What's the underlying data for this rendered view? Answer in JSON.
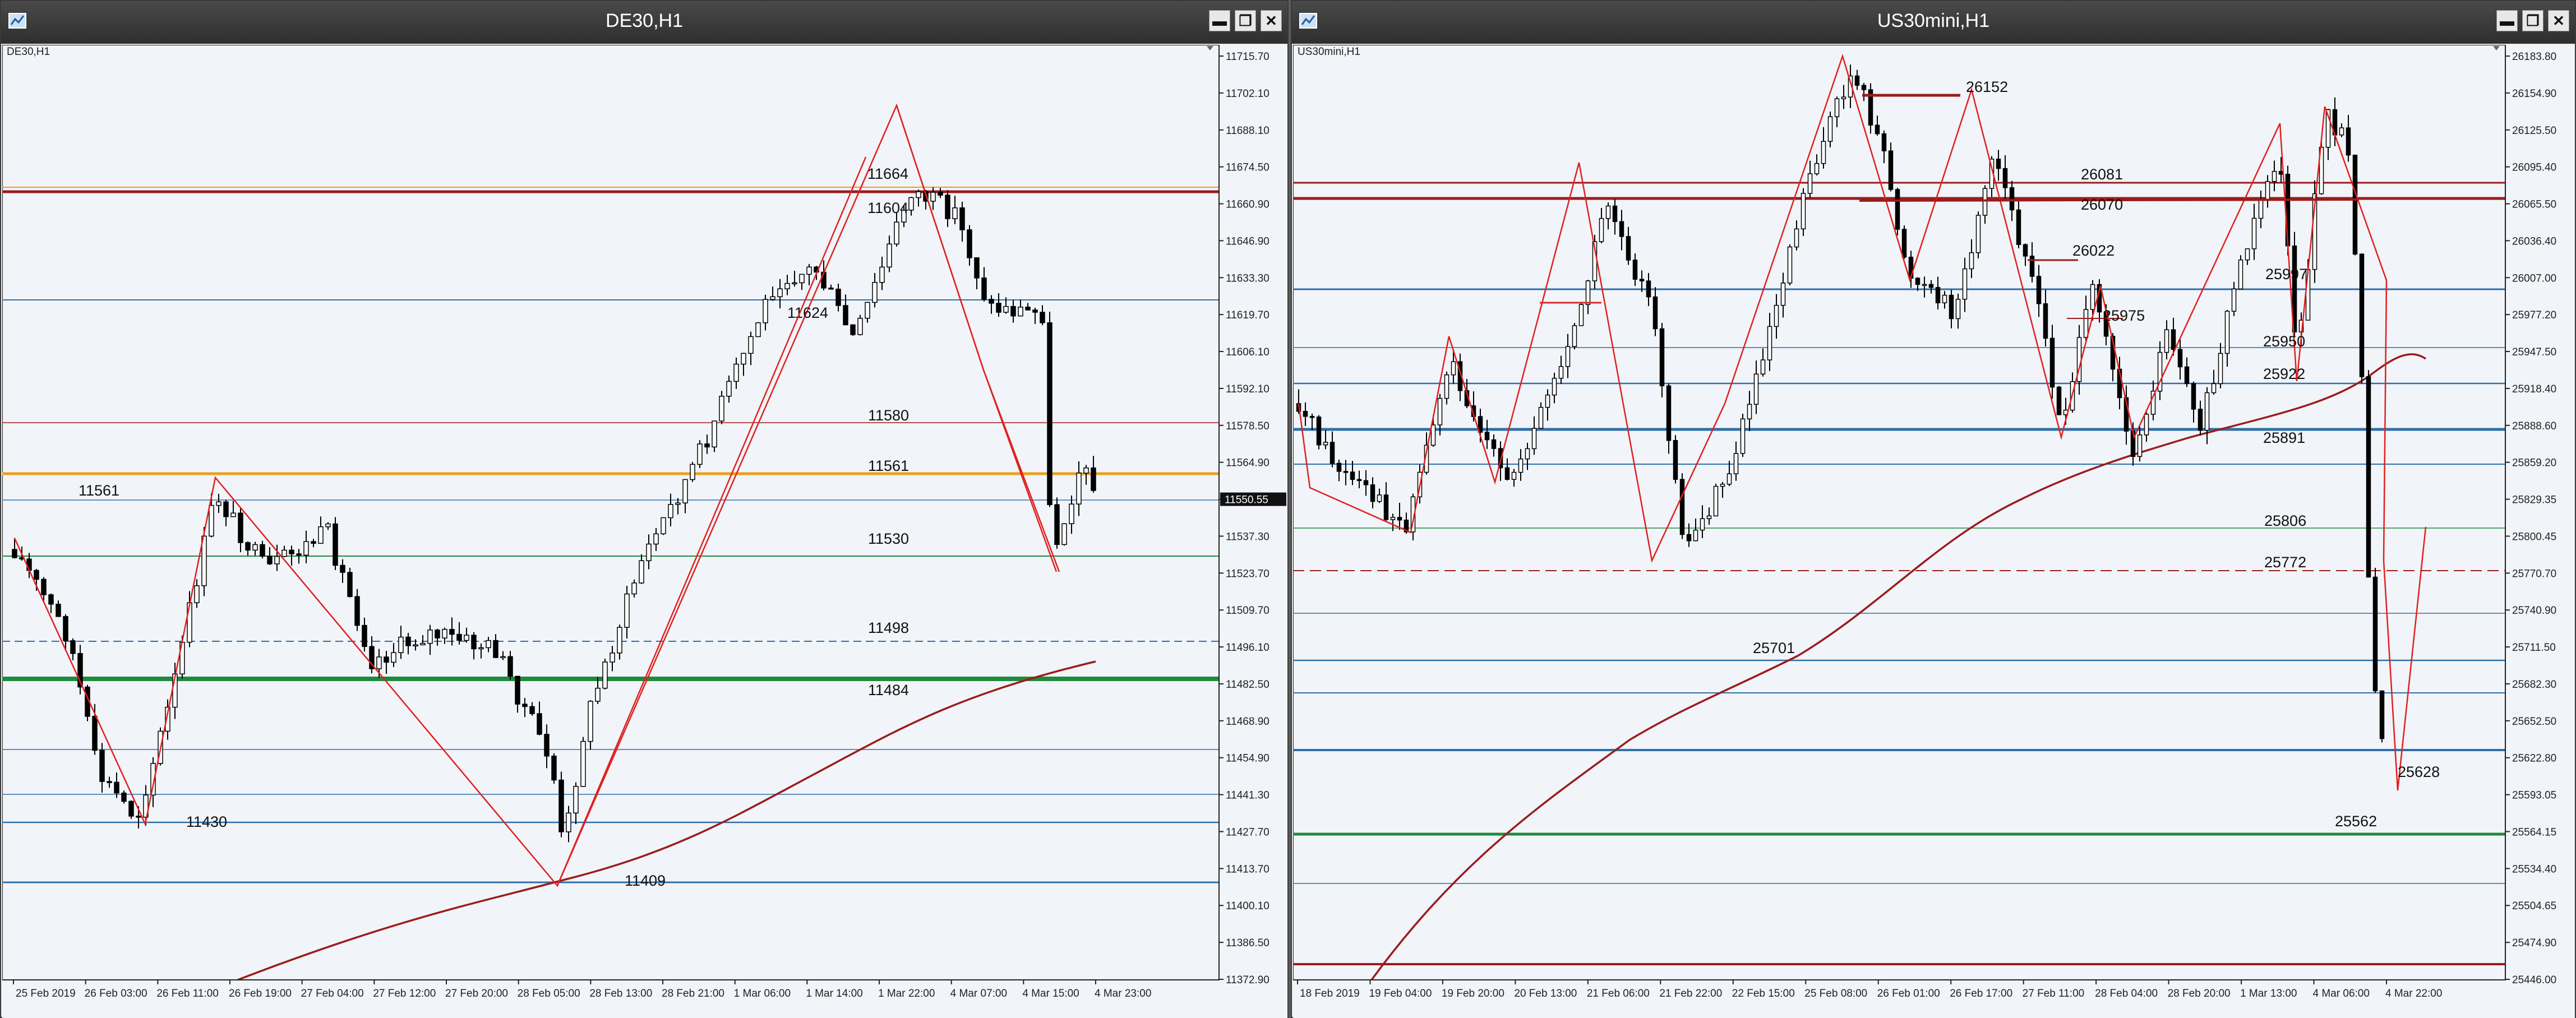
{
  "windows": [
    {
      "title": "DE30,H1",
      "symbol_label": "DE30,H1",
      "price_axis": [
        "11715.70",
        "11702.10",
        "11688.10",
        "11674.50",
        "11660.90",
        "11646.90",
        "11633.30",
        "11619.70",
        "11606.10",
        "11592.10",
        "11578.50",
        "11564.90",
        "11550.55",
        "11537.30",
        "11523.70",
        "11509.70",
        "11496.10",
        "11482.50",
        "11468.90",
        "11454.90",
        "11441.30",
        "11427.70",
        "11413.70",
        "11400.10",
        "11386.50",
        "11372.90"
      ],
      "current_price": "11550.55",
      "time_axis": [
        "25 Feb 2019",
        "26 Feb 03:00",
        "26 Feb 11:00",
        "26 Feb 19:00",
        "27 Feb 04:00",
        "27 Feb 12:00",
        "27 Feb 20:00",
        "28 Feb 05:00",
        "28 Feb 13:00",
        "28 Feb 21:00",
        "1 Mar 06:00",
        "1 Mar 14:00",
        "1 Mar 22:00",
        "4 Mar 07:00",
        "4 Mar 15:00",
        "4 Mar 23:00"
      ],
      "level_labels": [
        "11561",
        "11430",
        "11409",
        "11624",
        "11580",
        "11561",
        "11530",
        "11498",
        "11484",
        "11664",
        "11604"
      ]
    },
    {
      "title": "US30mini,H1",
      "symbol_label": "US30mini,H1",
      "price_axis": [
        "26183.80",
        "26154.90",
        "26125.50",
        "26095.40",
        "26065.50",
        "26036.40",
        "26007.00",
        "25977.20",
        "25947.50",
        "25918.40",
        "25888.60",
        "25859.20",
        "25829.35",
        "25800.45",
        "25770.70",
        "25740.90",
        "25711.50",
        "25682.30",
        "25652.50",
        "25622.80",
        "25593.05",
        "25564.15",
        "25534.40",
        "25504.65",
        "25474.90",
        "25446.00"
      ],
      "current_price": "25807.50",
      "time_axis": [
        "18 Feb 2019",
        "19 Feb 04:00",
        "19 Feb 20:00",
        "20 Feb 13:00",
        "21 Feb 06:00",
        "21 Feb 22:00",
        "22 Feb 15:00",
        "25 Feb 08:00",
        "26 Feb 01:00",
        "26 Feb 17:00",
        "27 Feb 11:00",
        "28 Feb 04:00",
        "28 Feb 20:00",
        "1 Mar 13:00",
        "4 Mar 06:00",
        "4 Mar 22:00"
      ],
      "level_labels": [
        "26152",
        "26081",
        "26070",
        "26022",
        "25997",
        "25975",
        "25950",
        "25922",
        "25891",
        "25806",
        "25772",
        "25701",
        "25628",
        "25562"
      ]
    }
  ],
  "colors": {
    "background": "#f1f4f9",
    "grid_blue": "#2f6fa8",
    "dark_red": "#9b1c1c",
    "orange": "#e7a11d",
    "green": "#1f8a3c",
    "zigzag": "#e0201e",
    "candle": "#000000"
  }
}
